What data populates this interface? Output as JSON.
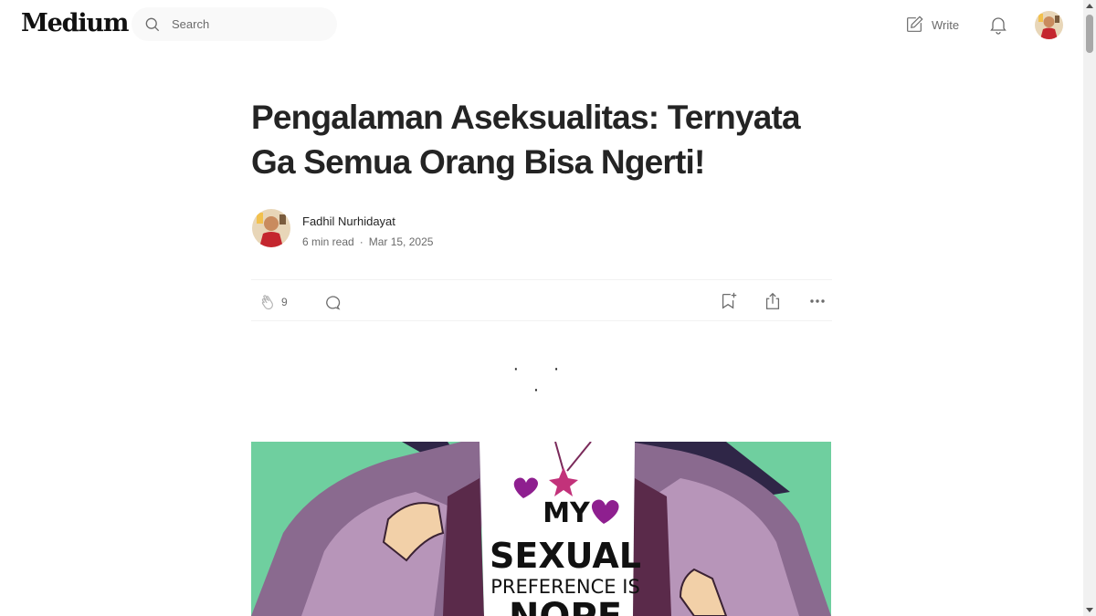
{
  "header": {
    "logo": "Medium",
    "search_placeholder": "Search",
    "write_label": "Write"
  },
  "article": {
    "title": "Pengalaman Aseksualitas: Ternyata Ga Semua Orang Bisa Ngerti!",
    "author": "Fadhil Nurhidayat",
    "read_time": "6 min read",
    "dot": "·",
    "date": "Mar 15, 2025",
    "clap_count": "9",
    "separator": "· · ·"
  },
  "hero_image": {
    "shirt_text_line1": "MY",
    "shirt_text_line2": "SEXUAL",
    "shirt_text_line3": "PREFERENCE IS",
    "shirt_text_line4": "NOPE"
  },
  "icons": {
    "search": "search-icon",
    "write": "write-icon",
    "bell": "bell-icon",
    "clap": "clap-icon",
    "comment": "comment-icon",
    "save": "bookmark-icon",
    "share": "share-icon",
    "more": "more-icon"
  },
  "colors": {
    "text": "#242424",
    "muted": "#6b6b6b",
    "hero_bg": "#6fcf9f",
    "hoodie": "#8a6a8f",
    "heart": "#8e1f8f"
  }
}
